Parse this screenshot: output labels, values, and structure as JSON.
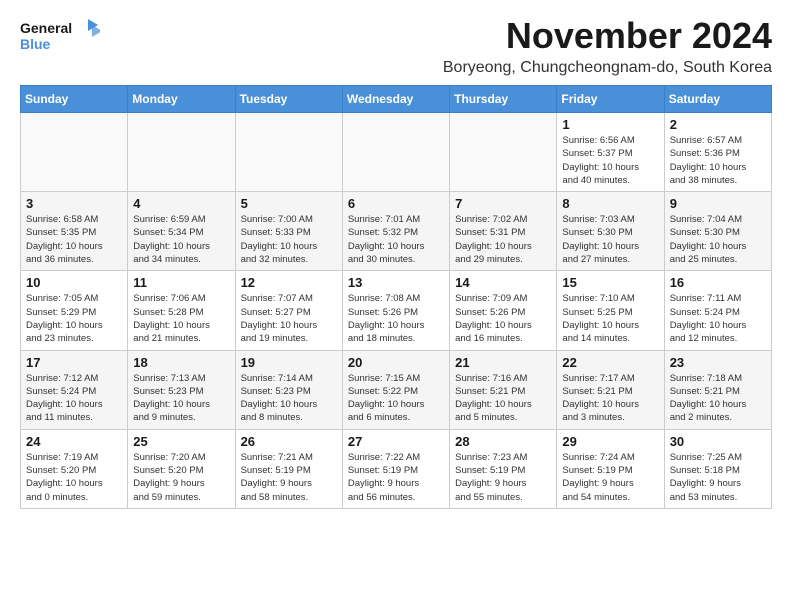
{
  "header": {
    "logo_line1": "General",
    "logo_line2": "Blue",
    "month_title": "November 2024",
    "location": "Boryeong, Chungcheongnam-do, South Korea"
  },
  "weekdays": [
    "Sunday",
    "Monday",
    "Tuesday",
    "Wednesday",
    "Thursday",
    "Friday",
    "Saturday"
  ],
  "weeks": [
    [
      {
        "day": "",
        "info": ""
      },
      {
        "day": "",
        "info": ""
      },
      {
        "day": "",
        "info": ""
      },
      {
        "day": "",
        "info": ""
      },
      {
        "day": "",
        "info": ""
      },
      {
        "day": "1",
        "info": "Sunrise: 6:56 AM\nSunset: 5:37 PM\nDaylight: 10 hours\nand 40 minutes."
      },
      {
        "day": "2",
        "info": "Sunrise: 6:57 AM\nSunset: 5:36 PM\nDaylight: 10 hours\nand 38 minutes."
      }
    ],
    [
      {
        "day": "3",
        "info": "Sunrise: 6:58 AM\nSunset: 5:35 PM\nDaylight: 10 hours\nand 36 minutes."
      },
      {
        "day": "4",
        "info": "Sunrise: 6:59 AM\nSunset: 5:34 PM\nDaylight: 10 hours\nand 34 minutes."
      },
      {
        "day": "5",
        "info": "Sunrise: 7:00 AM\nSunset: 5:33 PM\nDaylight: 10 hours\nand 32 minutes."
      },
      {
        "day": "6",
        "info": "Sunrise: 7:01 AM\nSunset: 5:32 PM\nDaylight: 10 hours\nand 30 minutes."
      },
      {
        "day": "7",
        "info": "Sunrise: 7:02 AM\nSunset: 5:31 PM\nDaylight: 10 hours\nand 29 minutes."
      },
      {
        "day": "8",
        "info": "Sunrise: 7:03 AM\nSunset: 5:30 PM\nDaylight: 10 hours\nand 27 minutes."
      },
      {
        "day": "9",
        "info": "Sunrise: 7:04 AM\nSunset: 5:30 PM\nDaylight: 10 hours\nand 25 minutes."
      }
    ],
    [
      {
        "day": "10",
        "info": "Sunrise: 7:05 AM\nSunset: 5:29 PM\nDaylight: 10 hours\nand 23 minutes."
      },
      {
        "day": "11",
        "info": "Sunrise: 7:06 AM\nSunset: 5:28 PM\nDaylight: 10 hours\nand 21 minutes."
      },
      {
        "day": "12",
        "info": "Sunrise: 7:07 AM\nSunset: 5:27 PM\nDaylight: 10 hours\nand 19 minutes."
      },
      {
        "day": "13",
        "info": "Sunrise: 7:08 AM\nSunset: 5:26 PM\nDaylight: 10 hours\nand 18 minutes."
      },
      {
        "day": "14",
        "info": "Sunrise: 7:09 AM\nSunset: 5:26 PM\nDaylight: 10 hours\nand 16 minutes."
      },
      {
        "day": "15",
        "info": "Sunrise: 7:10 AM\nSunset: 5:25 PM\nDaylight: 10 hours\nand 14 minutes."
      },
      {
        "day": "16",
        "info": "Sunrise: 7:11 AM\nSunset: 5:24 PM\nDaylight: 10 hours\nand 12 minutes."
      }
    ],
    [
      {
        "day": "17",
        "info": "Sunrise: 7:12 AM\nSunset: 5:24 PM\nDaylight: 10 hours\nand 11 minutes."
      },
      {
        "day": "18",
        "info": "Sunrise: 7:13 AM\nSunset: 5:23 PM\nDaylight: 10 hours\nand 9 minutes."
      },
      {
        "day": "19",
        "info": "Sunrise: 7:14 AM\nSunset: 5:23 PM\nDaylight: 10 hours\nand 8 minutes."
      },
      {
        "day": "20",
        "info": "Sunrise: 7:15 AM\nSunset: 5:22 PM\nDaylight: 10 hours\nand 6 minutes."
      },
      {
        "day": "21",
        "info": "Sunrise: 7:16 AM\nSunset: 5:21 PM\nDaylight: 10 hours\nand 5 minutes."
      },
      {
        "day": "22",
        "info": "Sunrise: 7:17 AM\nSunset: 5:21 PM\nDaylight: 10 hours\nand 3 minutes."
      },
      {
        "day": "23",
        "info": "Sunrise: 7:18 AM\nSunset: 5:21 PM\nDaylight: 10 hours\nand 2 minutes."
      }
    ],
    [
      {
        "day": "24",
        "info": "Sunrise: 7:19 AM\nSunset: 5:20 PM\nDaylight: 10 hours\nand 0 minutes."
      },
      {
        "day": "25",
        "info": "Sunrise: 7:20 AM\nSunset: 5:20 PM\nDaylight: 9 hours\nand 59 minutes."
      },
      {
        "day": "26",
        "info": "Sunrise: 7:21 AM\nSunset: 5:19 PM\nDaylight: 9 hours\nand 58 minutes."
      },
      {
        "day": "27",
        "info": "Sunrise: 7:22 AM\nSunset: 5:19 PM\nDaylight: 9 hours\nand 56 minutes."
      },
      {
        "day": "28",
        "info": "Sunrise: 7:23 AM\nSunset: 5:19 PM\nDaylight: 9 hours\nand 55 minutes."
      },
      {
        "day": "29",
        "info": "Sunrise: 7:24 AM\nSunset: 5:19 PM\nDaylight: 9 hours\nand 54 minutes."
      },
      {
        "day": "30",
        "info": "Sunrise: 7:25 AM\nSunset: 5:18 PM\nDaylight: 9 hours\nand 53 minutes."
      }
    ]
  ]
}
